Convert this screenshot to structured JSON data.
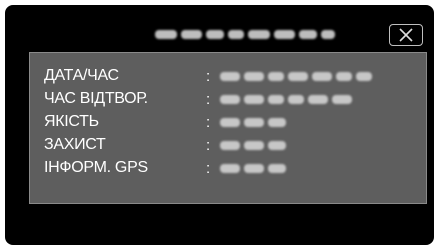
{
  "dialog": {
    "title_blocks": [
      22,
      22,
      18,
      16,
      22,
      22,
      18,
      14
    ],
    "close_icon": "close-x-icon"
  },
  "info_rows": [
    {
      "label": "ДАТА/ЧАС",
      "separator": ":",
      "value_blocks": [
        20,
        20,
        16,
        20,
        20,
        16,
        16
      ]
    },
    {
      "label": "ЧАС ВІДТВОР.",
      "separator": ":",
      "value_blocks": [
        20,
        20,
        16,
        16,
        20,
        20
      ]
    },
    {
      "label": "ЯКІСТЬ",
      "separator": ":",
      "value_blocks": [
        20,
        20,
        18
      ]
    },
    {
      "label": "ЗАХИСТ",
      "separator": ":",
      "value_blocks": [
        20,
        20,
        18
      ]
    },
    {
      "label": "ІНФОРМ. GPS",
      "separator": ":",
      "value_blocks": [
        20,
        20,
        18
      ]
    }
  ]
}
